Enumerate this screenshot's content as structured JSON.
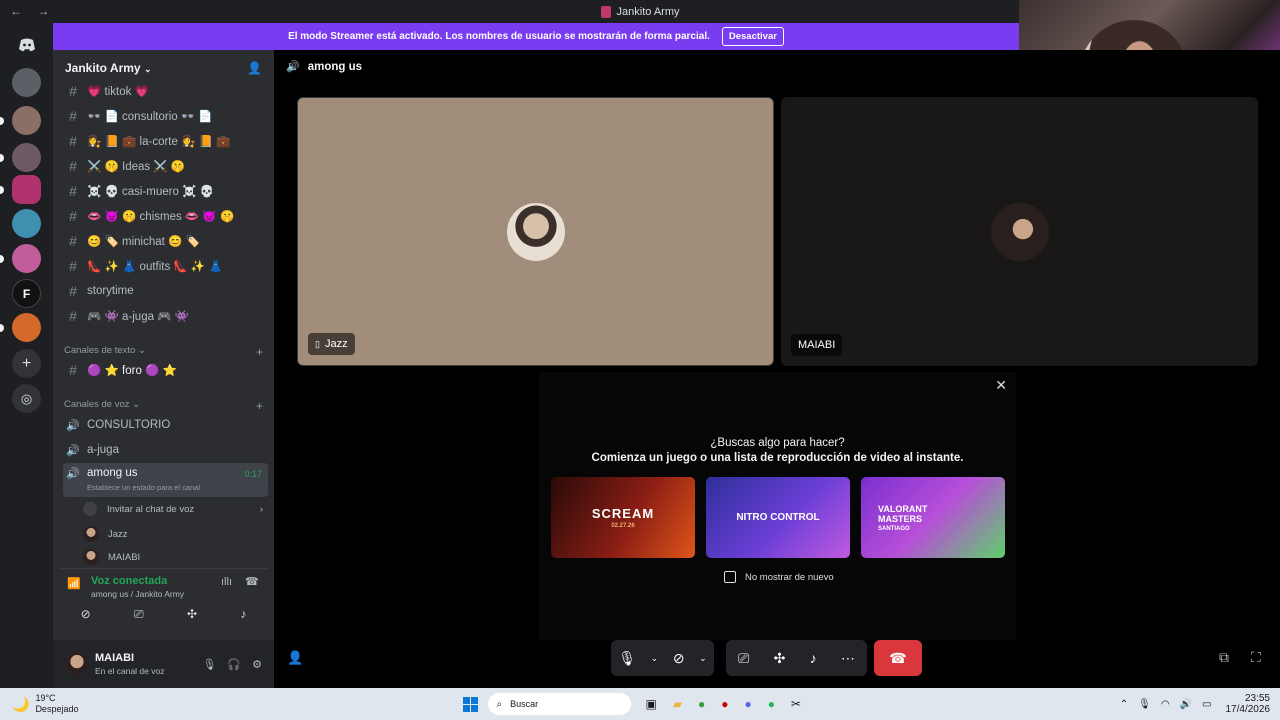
{
  "window": {
    "title": "Jankito Army"
  },
  "banner": {
    "text": "El modo Streamer está activado. Los nombres de usuario se mostrarán de forma parcial.",
    "button": "Desactivar"
  },
  "server": {
    "name": "Jankito Army"
  },
  "channels": [
    {
      "name": "💗 tiktok 💗"
    },
    {
      "name": "👓 📄 consultorio 👓 📄"
    },
    {
      "name": "👩‍⚖️ 📙 💼 la-corte 👩‍⚖️ 📙 💼"
    },
    {
      "name": "⚔️ 🤫 Ideas ⚔️ 🤫"
    },
    {
      "name": "☠️ 💀 casi-muero ☠️ 💀"
    },
    {
      "name": "👄 👿 🤫 chismes 👄 👿 🤫"
    },
    {
      "name": "😊 🏷️ minichat 😊 🏷️"
    },
    {
      "name": "👠 ✨ 👗 outfits 👠 ✨ 👗"
    },
    {
      "name": "storytime"
    },
    {
      "name": "🎮 👾 a-juga 🎮 👾"
    }
  ],
  "categories": {
    "text": "Canales de texto",
    "voice": "Canales de voz"
  },
  "forum": {
    "name": "🟣 ⭐ foro 🟣 ⭐"
  },
  "voice_channels": [
    {
      "name": "CONSULTORIO"
    },
    {
      "name": "a-juga"
    },
    {
      "name": "among us",
      "timer": "0:17",
      "status": "Establece un estado para el canal"
    }
  ],
  "voice_members": {
    "invite": "Invitar al chat de voz",
    "m1": "Jazz",
    "m2": "MAIABI"
  },
  "voice_panel": {
    "status": "Voz conectada",
    "location": "among us / Jankito Army"
  },
  "user": {
    "name": "MAIABI",
    "status": "En el canal de voz"
  },
  "call": {
    "channel": "among us",
    "tiles": [
      {
        "name": "Jazz"
      },
      {
        "name": "MAIABI"
      }
    ]
  },
  "activity": {
    "title": "¿Buscas algo para hacer?",
    "subtitle": "Comienza un juego o una lista de reproducción de video al instante.",
    "cards": [
      {
        "label": "SCREAM",
        "sub": "02.27.26"
      },
      {
        "label": "NITRO CONTROL"
      },
      {
        "label": "VALORANT MASTERS",
        "sub": "SANTIAGO"
      }
    ],
    "checkbox": "No mostrar de nuevo"
  },
  "taskbar": {
    "weather_temp": "19°C",
    "weather_text": "Despejado",
    "search": "Buscar",
    "time": "23:55",
    "date": "17/4/2026"
  },
  "colors": {
    "accent": "#7a3cf0",
    "green": "#23a55a",
    "danger": "#da373c"
  }
}
